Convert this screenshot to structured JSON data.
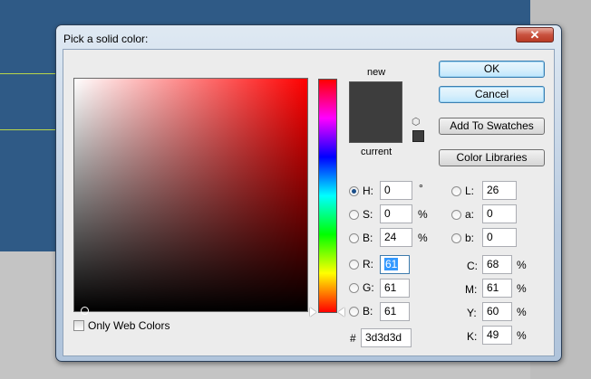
{
  "dialog": {
    "title": "Pick a solid color:",
    "close_glyph": "✕"
  },
  "preview": {
    "new_label": "new",
    "current_label": "current",
    "new_color": "#3d3d3d",
    "current_color": "#3d3d3d",
    "gamut_icon": "cube-icon"
  },
  "buttons": {
    "ok": "OK",
    "cancel": "Cancel",
    "add_to_swatches": "Add To Swatches",
    "color_libraries": "Color Libraries"
  },
  "hsb": {
    "h": {
      "label": "H:",
      "value": "0",
      "unit": "°"
    },
    "s": {
      "label": "S:",
      "value": "0",
      "unit": "%"
    },
    "b": {
      "label": "B:",
      "value": "24",
      "unit": "%"
    }
  },
  "rgb": {
    "r": {
      "label": "R:",
      "value": "61"
    },
    "g": {
      "label": "G:",
      "value": "61"
    },
    "b": {
      "label": "B:",
      "value": "61"
    }
  },
  "lab": {
    "l": {
      "label": "L:",
      "value": "26"
    },
    "a": {
      "label": "a:",
      "value": "0"
    },
    "b": {
      "label": "b:",
      "value": "0"
    }
  },
  "cmyk": {
    "c": {
      "label": "C:",
      "value": "68",
      "unit": "%"
    },
    "m": {
      "label": "M:",
      "value": "61",
      "unit": "%"
    },
    "y": {
      "label": "Y:",
      "value": "60",
      "unit": "%"
    },
    "k": {
      "label": "K:",
      "value": "49",
      "unit": "%"
    }
  },
  "hex": {
    "label": "#",
    "value": "3d3d3d"
  },
  "only_web_colors": {
    "label": "Only Web Colors",
    "checked": false
  },
  "selected_mode": "H",
  "field_hue_color": "#ff0000"
}
